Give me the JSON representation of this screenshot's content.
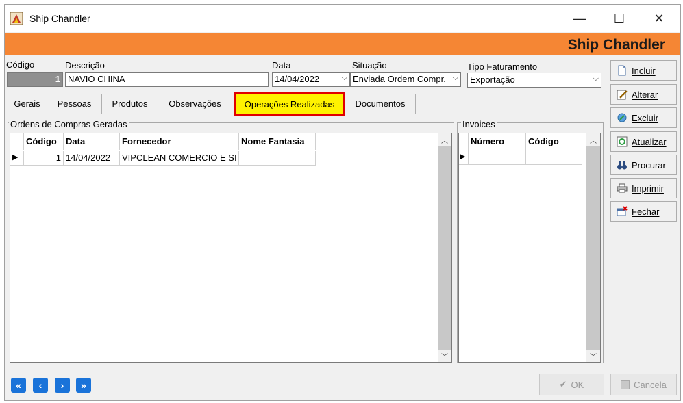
{
  "window": {
    "title": "Ship Chandler",
    "minimize_glyph": "—",
    "maximize_glyph": "☐",
    "close_glyph": "✕"
  },
  "header": {
    "brand": "Ship Chandler"
  },
  "form": {
    "codigo_label": "Código",
    "codigo_value": "1",
    "descricao_label": "Descrição",
    "descricao_value": "NAVIO CHINA",
    "data_label": "Data",
    "data_value": "14/04/2022",
    "situacao_label": "Situação",
    "situacao_value": "Enviada Ordem Compr.",
    "tipo_label": "Tipo Faturamento",
    "tipo_value": "Exportação"
  },
  "tabs": [
    {
      "label": "Gerais"
    },
    {
      "label": "Pessoas"
    },
    {
      "label": "Produtos"
    },
    {
      "label": "Observações"
    },
    {
      "label": "Operações Realizadas"
    },
    {
      "label": "Documentos"
    }
  ],
  "ordens": {
    "group_label": "Ordens de Compras Geradas",
    "columns": [
      "Código",
      "Data",
      "Fornecedor",
      "Nome Fantasia"
    ],
    "rows": [
      {
        "codigo": "1",
        "data": "14/04/2022",
        "fornecedor": "VIPCLEAN COMERCIO E SI",
        "nome_fantasia": ""
      }
    ]
  },
  "invoices": {
    "group_label": "Invoices",
    "columns": [
      "Número",
      "Código"
    ]
  },
  "side_buttons": [
    {
      "label": "Incluir",
      "icon": "new-document-icon"
    },
    {
      "label": "Alterar",
      "icon": "edit-pencil-icon"
    },
    {
      "label": "Excluir",
      "icon": "delete-icon"
    },
    {
      "label": "Atualizar",
      "icon": "refresh-icon"
    },
    {
      "label": "Procurar",
      "icon": "binoculars-icon"
    },
    {
      "label": "Imprimir",
      "icon": "printer-icon"
    },
    {
      "label": "Fechar",
      "icon": "close-window-icon"
    }
  ],
  "bottom": {
    "ok_label": "OK",
    "cancel_label": "Cancela"
  },
  "colors": {
    "accent": "#f58634",
    "tab_highlight": "#fff200",
    "tab_border": "#e00000",
    "nav_blue": "#1a73d9"
  }
}
